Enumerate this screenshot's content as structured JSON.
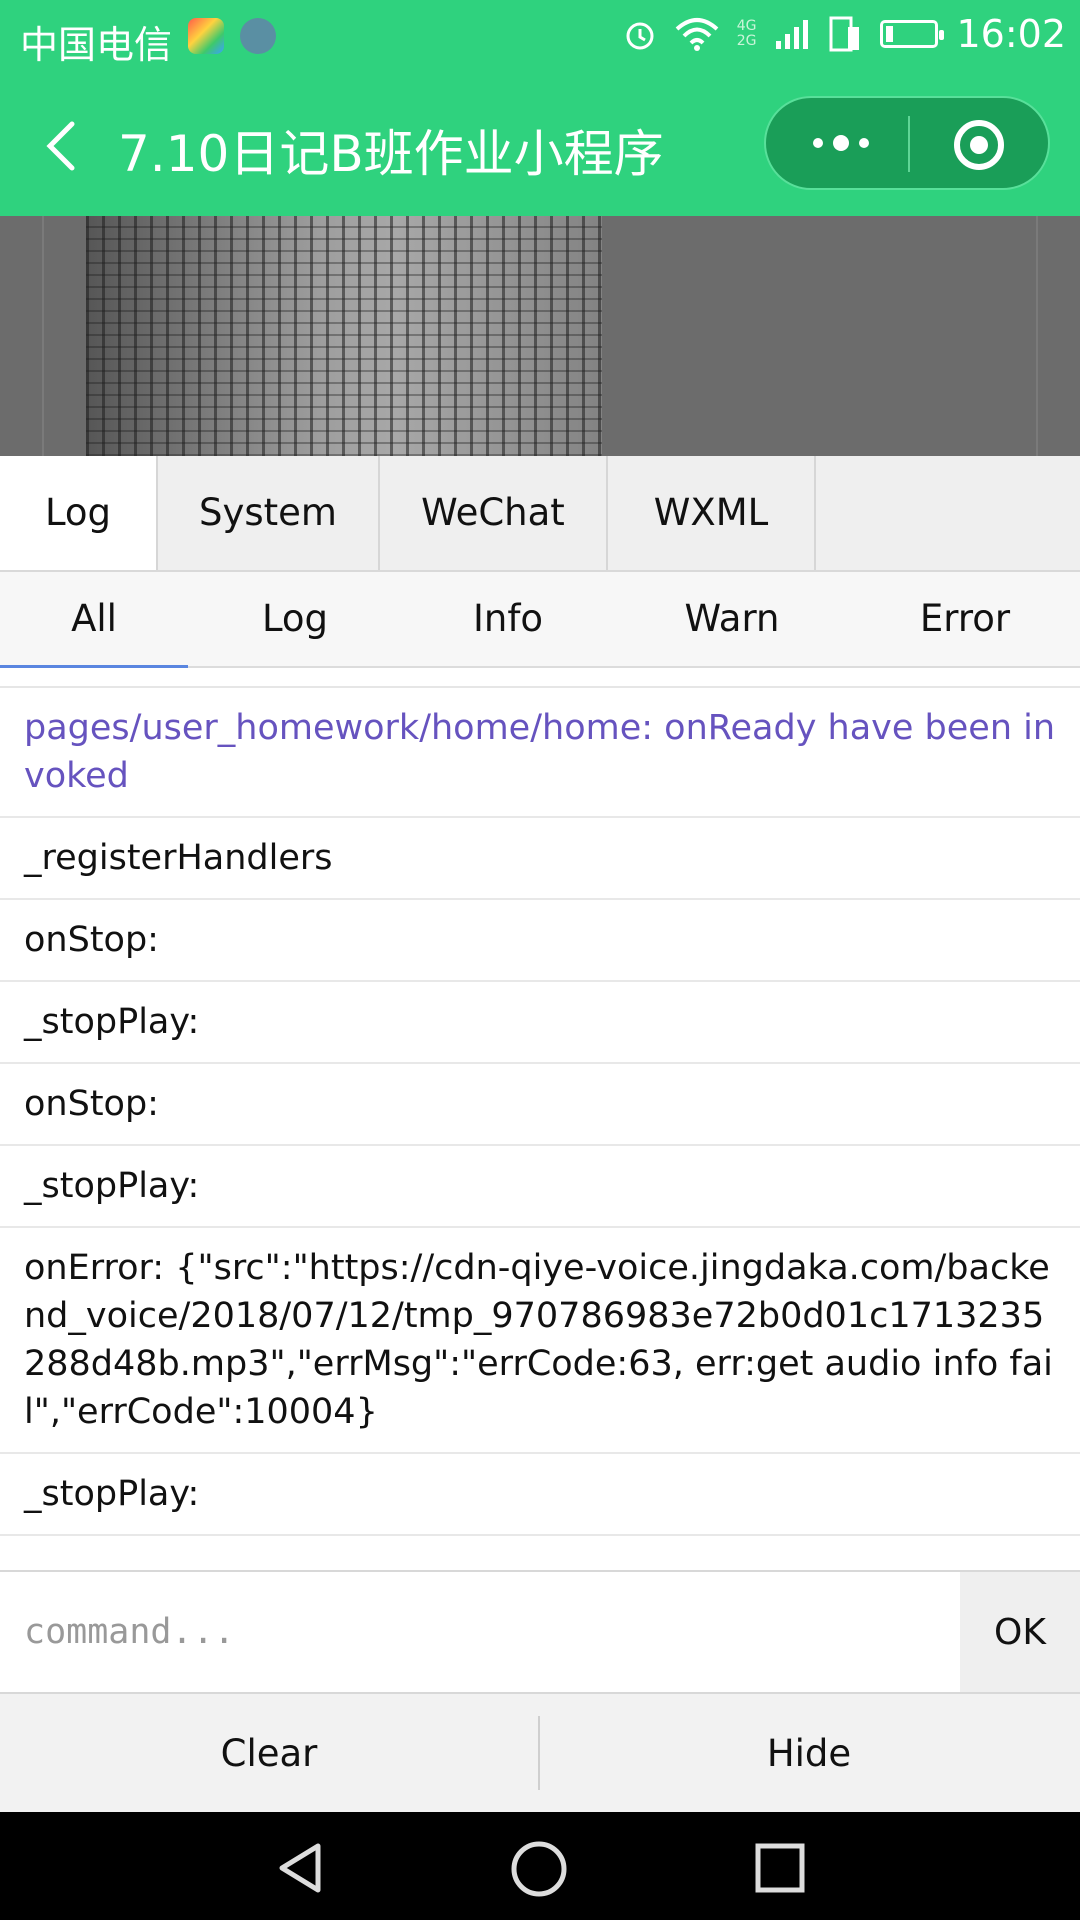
{
  "status_bar": {
    "carrier": "中国电信",
    "time": "16:02",
    "network_badge_top": "4G",
    "network_badge_bottom": "2G"
  },
  "nav": {
    "title": "7.10日记B班作业小程序"
  },
  "tabs": [
    {
      "label": "Log",
      "active": true
    },
    {
      "label": "System",
      "active": false
    },
    {
      "label": "WeChat",
      "active": false
    },
    {
      "label": "WXML",
      "active": false
    }
  ],
  "filters": [
    {
      "label": "All",
      "active": true
    },
    {
      "label": "Log",
      "active": false
    },
    {
      "label": "Info",
      "active": false
    },
    {
      "label": "Warn",
      "active": false
    },
    {
      "label": "Error",
      "active": false
    }
  ],
  "logs": [
    {
      "text": "pages/user_homework/home/home: onReady have been invoked",
      "level": "info"
    },
    {
      "text": "_registerHandlers",
      "level": "log"
    },
    {
      "text": "onStop:",
      "level": "log"
    },
    {
      "text": "_stopPlay:",
      "level": "log"
    },
    {
      "text": "onStop:",
      "level": "log"
    },
    {
      "text": "_stopPlay:",
      "level": "log"
    },
    {
      "text": "onError: {\"src\":\"https://cdn-qiye-voice.jingdaka.com/backend_voice/2018/07/12/tmp_970786983e72b0d01c1713235288d48b.mp3\",\"errMsg\":\"errCode:63, err:get audio info fail\",\"errCode\":10004}",
      "level": "log"
    },
    {
      "text": "_stopPlay:",
      "level": "log"
    }
  ],
  "command": {
    "placeholder": "command...",
    "ok_label": "OK"
  },
  "footer": {
    "clear_label": "Clear",
    "hide_label": "Hide"
  },
  "colors": {
    "brand_green": "#2fd27e",
    "info_text": "#6653bf",
    "active_filter_underline": "#5a86e0"
  }
}
